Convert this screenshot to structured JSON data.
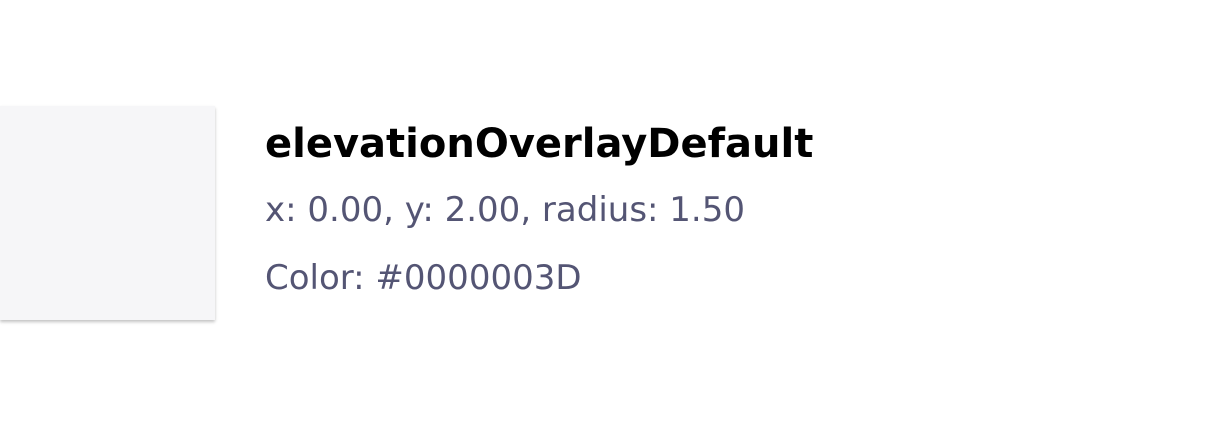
{
  "token": {
    "name": "elevationOverlayDefault",
    "shadow_params": "x: 0.00, y: 2.00, radius: 1.50",
    "color_text": "Color: #0000003D"
  },
  "colors": {
    "swatch_fill": "#f6f6f8",
    "shadow_color": "#0000003D",
    "title_text": "#000000",
    "detail_text": "#545574"
  }
}
